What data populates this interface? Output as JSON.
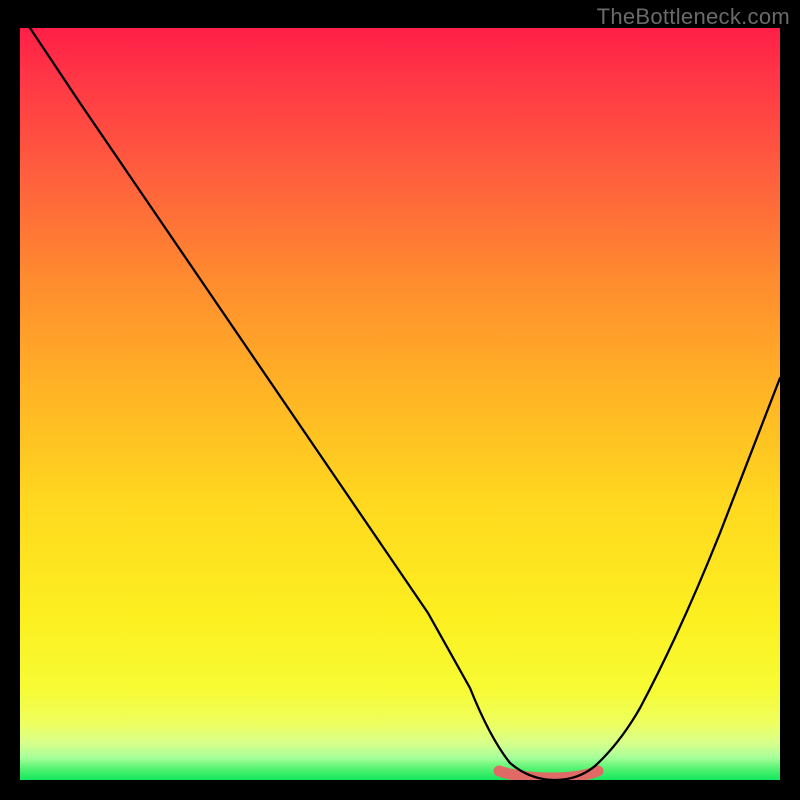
{
  "watermark": "TheBottleneck.com",
  "colors": {
    "gradient_top": "#ff1f47",
    "gradient_mid": "#ffd81f",
    "gradient_bottom": "#12e85e",
    "curve": "#000000",
    "bottom_marker": "#e06a65",
    "frame": "#000000"
  },
  "chart_data": {
    "type": "line",
    "title": "",
    "xlabel": "",
    "ylabel": "",
    "xlim": [
      0,
      100
    ],
    "ylim": [
      0,
      100
    ],
    "series": [
      {
        "name": "bottleneck-curve",
        "x": [
          0,
          5,
          10,
          15,
          20,
          25,
          30,
          35,
          40,
          45,
          50,
          55,
          60,
          63,
          67,
          70,
          73,
          76,
          80,
          85,
          90,
          95,
          100
        ],
        "y": [
          100,
          94,
          87,
          79,
          71,
          63,
          55,
          47,
          39,
          31,
          23,
          15,
          8,
          4,
          1,
          0,
          0,
          1,
          4,
          11,
          22,
          37,
          55
        ]
      }
    ],
    "annotations": [
      {
        "name": "optimal-band",
        "x_start": 63,
        "x_end": 76,
        "y": 0,
        "color": "#e06a65"
      }
    ]
  }
}
